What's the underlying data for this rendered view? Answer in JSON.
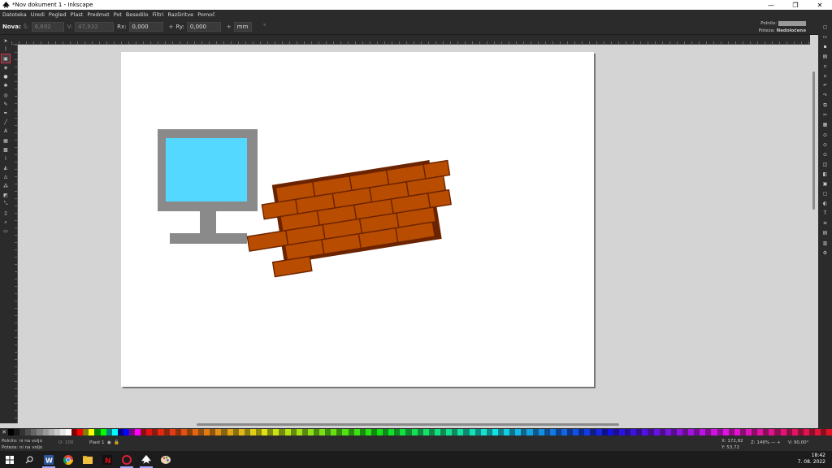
{
  "window": {
    "title": "*Nov dokument 1 - Inkscape",
    "minimize": "—",
    "restore": "❐",
    "close": "✕"
  },
  "menu": [
    "Datoteka",
    "Uredi",
    "Pogled",
    "Plast",
    "Predmet",
    "Pot",
    "Besedilo",
    "Filtri",
    "Razširitve",
    "Pomoč"
  ],
  "toolctrl": {
    "mode": "Nova:",
    "s_label": "Š:",
    "s_value": "6,692",
    "v_label": "V:",
    "v_value": "47,932",
    "rx_label": "Rx:",
    "rx_value": "0,000",
    "ry_label": "Ry:",
    "ry_value": "0,000",
    "unit": "mm"
  },
  "style_indicator": {
    "fill_label": "Polnilo:",
    "stroke_label": "Poteza:",
    "stroke_value": "Nedoločeno"
  },
  "status": {
    "fill_label": "Polnilo:",
    "fill_value": "ni na voljo",
    "stroke_label": "Poteza:",
    "stroke_value": "ni na voljo",
    "opacity_label": "O:",
    "opacity_value": "100",
    "layer": "Plast 1"
  },
  "coords": {
    "x_label": "X:",
    "x": "172,92",
    "y_label": "Y:",
    "y": "53,72"
  },
  "zoom": {
    "label": "Z:",
    "value": "146%"
  },
  "rotation": {
    "label": "V:",
    "value": "90,00°"
  },
  "clock": {
    "time": "18:42",
    "date": "7. 08. 2022"
  },
  "colors": {
    "monitor_frame": "#8a8a8a",
    "monitor_screen": "#55d8ff",
    "brick": "#b84c00",
    "mortar": "#6b2300"
  }
}
